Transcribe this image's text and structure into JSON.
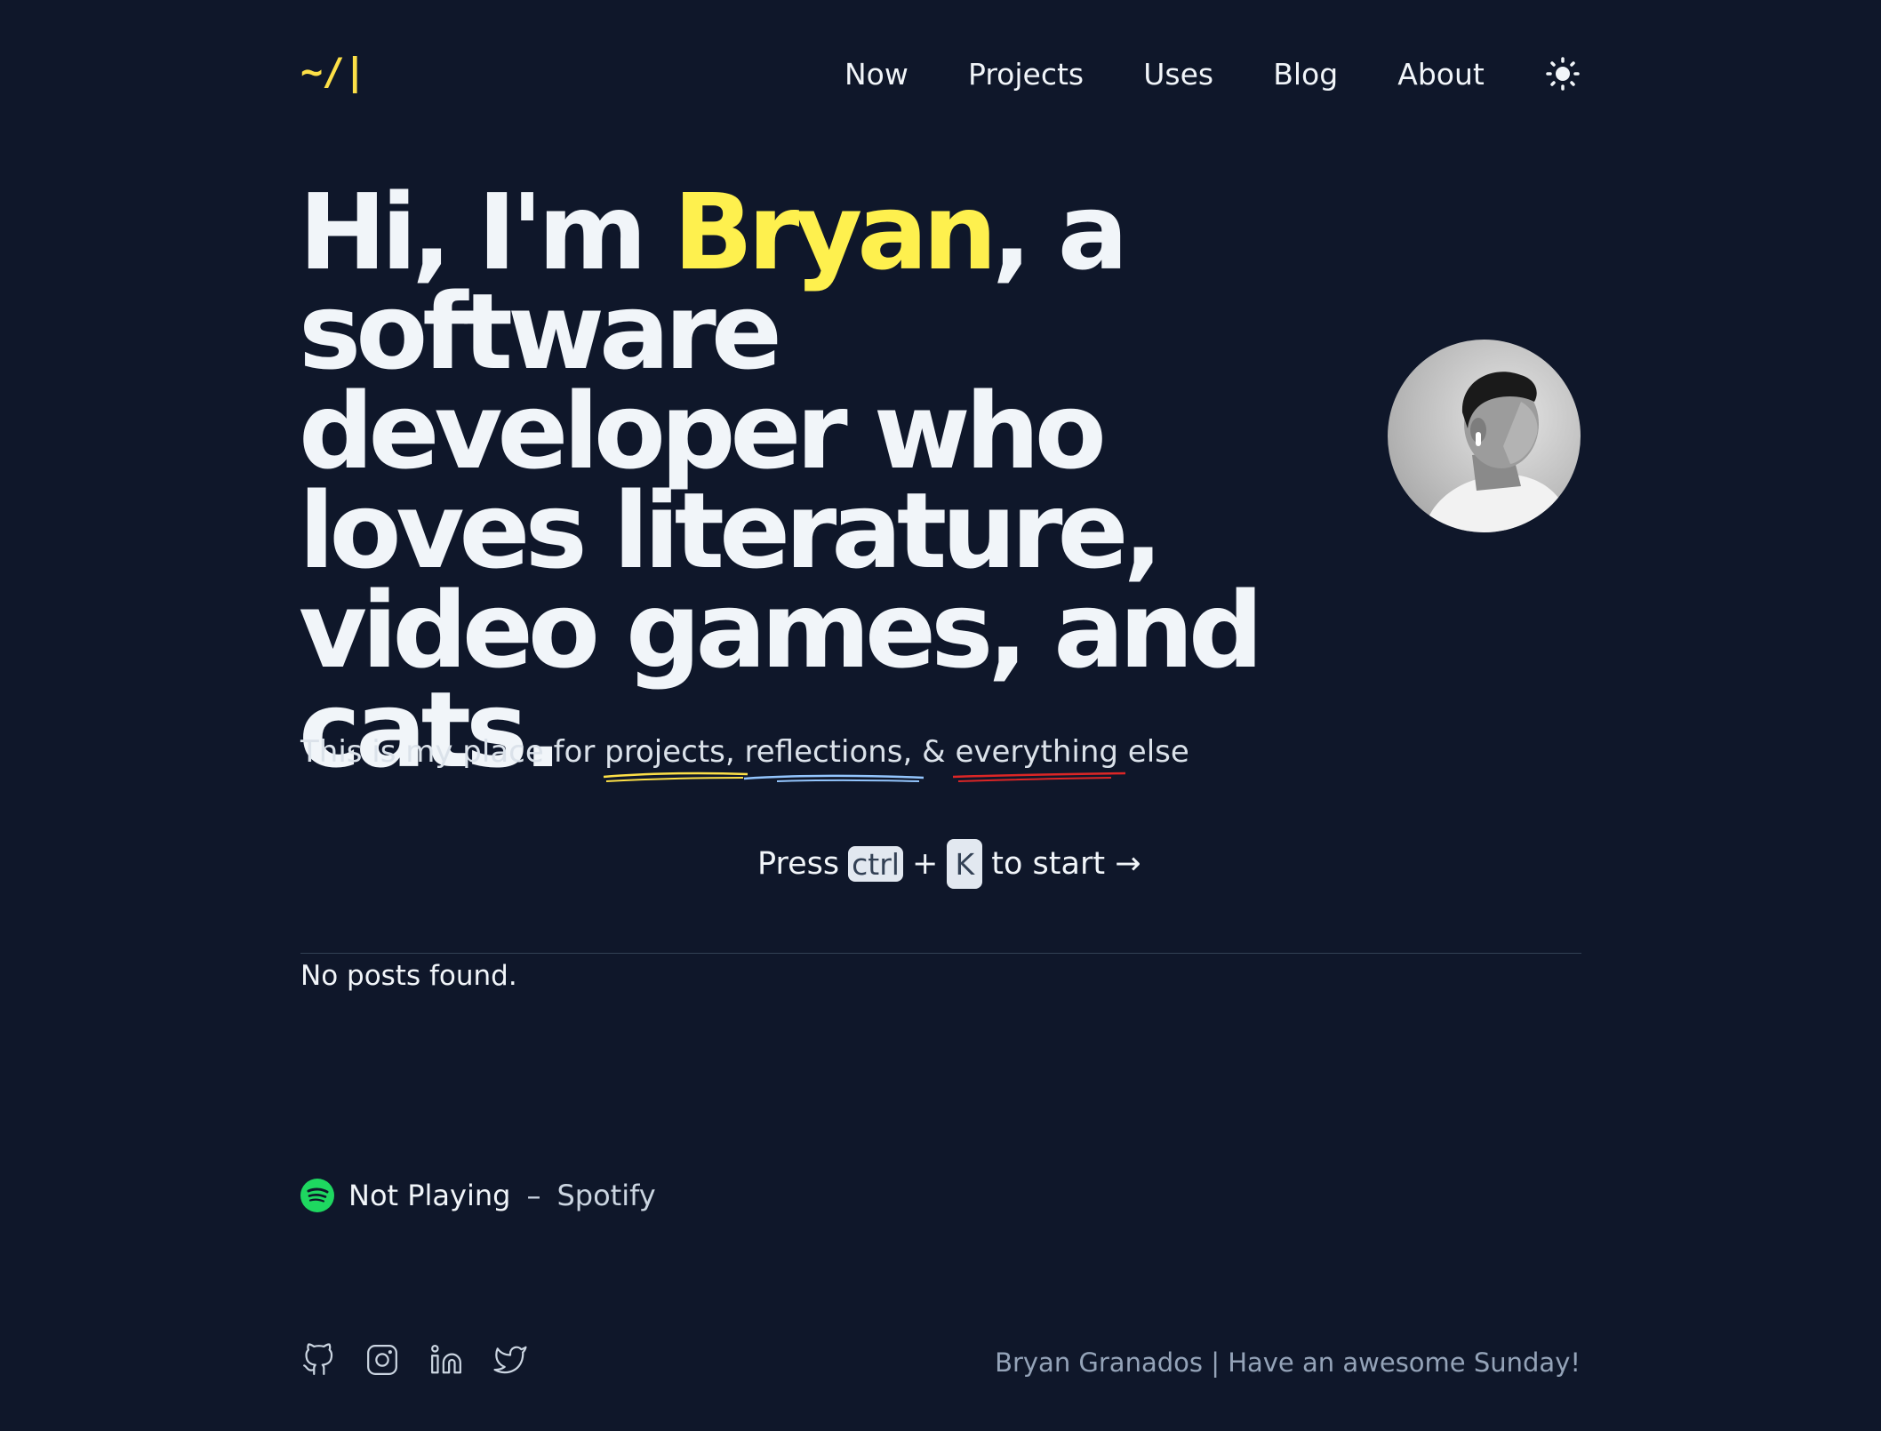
{
  "header": {
    "logo": "~/|",
    "nav": [
      "Now",
      "Projects",
      "Uses",
      "Blog",
      "About"
    ]
  },
  "hero": {
    "greeting": "Hi, I'm ",
    "name": "Bryan",
    "rest": ", a software developer who loves literature, video games, and cats."
  },
  "tagline": {
    "prefix": "This is my place for ",
    "projects": "projects,",
    "reflections": "reflections,",
    "amp": " & ",
    "everything": "everything",
    "else": " else"
  },
  "press_hint": {
    "press": "Press",
    "ctrl": "ctrl",
    "plus": "+",
    "key": "K",
    "to_start": "to start →"
  },
  "posts": {
    "empty": "No posts found."
  },
  "now_playing": {
    "status": "Not Playing",
    "separator": "–",
    "service": "Spotify"
  },
  "footer": {
    "socials": [
      "github-icon",
      "instagram-icon",
      "linkedin-icon",
      "twitter-icon"
    ],
    "signature": "Bryan Granados | Have an awesome Sunday!"
  },
  "colors": {
    "background": "#0f172a",
    "accent": "#fef04e",
    "spotify": "#1ed760",
    "underline_projects": "#fde047",
    "underline_reflections": "#93c5fd",
    "underline_everything": "#dc2626"
  }
}
